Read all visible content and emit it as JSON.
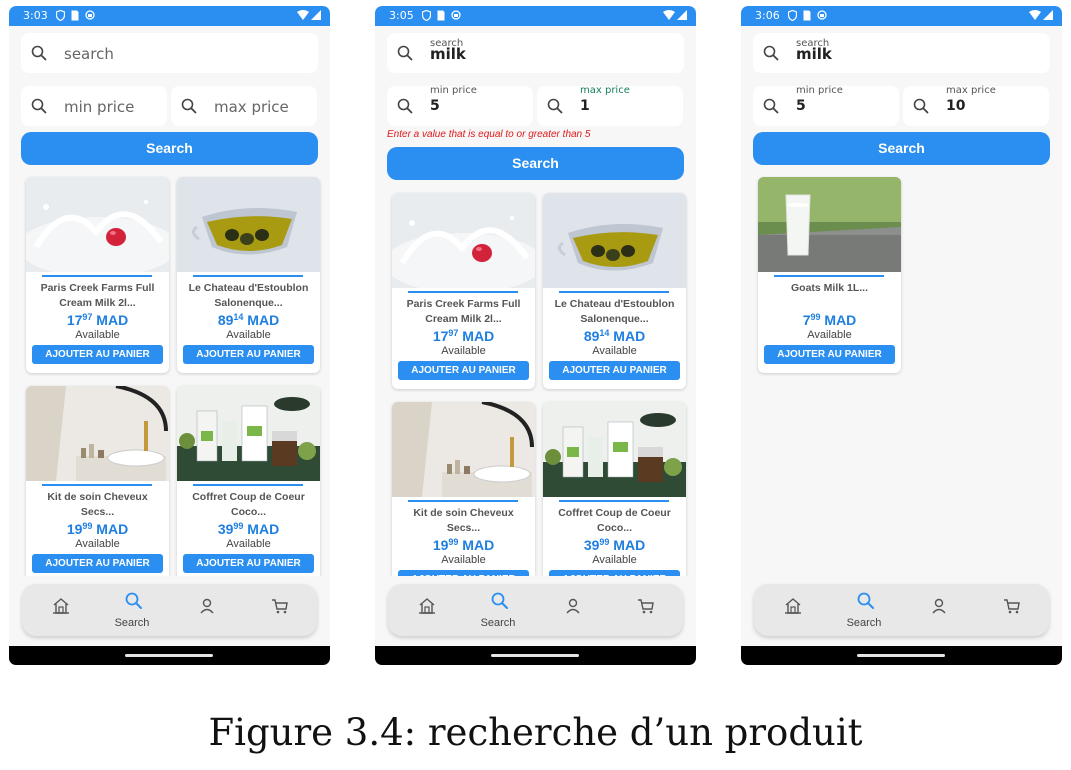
{
  "colors": {
    "accent": "#2a8ff0",
    "price": "#1e7fe0",
    "error": "#e01919",
    "label_green": "#17805a"
  },
  "screens": [
    {
      "time": "3:03",
      "search": {
        "label": "",
        "value": "",
        "placeholder": "search"
      },
      "min_price": {
        "label": "",
        "value": "",
        "placeholder": "min price"
      },
      "max_price": {
        "label": "",
        "value": "",
        "placeholder": "max price"
      },
      "error": "",
      "search_button": "Search",
      "products": [
        {
          "name1": "Paris Creek Farms Full",
          "name2": "Cream Milk 2l...",
          "price_int": "17",
          "price_dec": "97",
          "currency": "MAD",
          "availability": "Available",
          "cart": "AJOUTER AU PANIER",
          "image": "milk-splash"
        },
        {
          "name1": "Le Chateau d'Estoublon",
          "name2": "Salonenque...",
          "price_int": "89",
          "price_dec": "14",
          "currency": "MAD",
          "availability": "Available",
          "cart": "AJOUTER AU PANIER",
          "image": "olive-oil"
        },
        {
          "name1": "Kit de soin Cheveux",
          "name2": "Secs...",
          "price_int": "19",
          "price_dec": "99",
          "currency": "MAD",
          "availability": "Available",
          "cart": "AJOUTER AU PANIER",
          "image": "bathroom"
        },
        {
          "name1": "Coffret Coup de Coeur",
          "name2": "Coco...",
          "price_int": "39",
          "price_dec": "99",
          "currency": "MAD",
          "availability": "Available",
          "cart": "AJOUTER AU PANIER",
          "image": "cosmetics"
        }
      ],
      "nav": {
        "active": "Search"
      }
    },
    {
      "time": "3:05",
      "search": {
        "label": "search",
        "value": "milk",
        "placeholder": ""
      },
      "min_price": {
        "label": "min price",
        "value": "5",
        "placeholder": ""
      },
      "max_price": {
        "label": "max price",
        "value": "1",
        "placeholder": ""
      },
      "error": "Enter a value that is equal to or greater than 5",
      "search_button": "Search",
      "products": [
        {
          "name1": "Paris Creek Farms Full",
          "name2": "Cream Milk 2l...",
          "price_int": "17",
          "price_dec": "97",
          "currency": "MAD",
          "availability": "Available",
          "cart": "AJOUTER AU PANIER",
          "image": "milk-splash"
        },
        {
          "name1": "Le Chateau d'Estoublon",
          "name2": "Salonenque...",
          "price_int": "89",
          "price_dec": "14",
          "currency": "MAD",
          "availability": "Available",
          "cart": "AJOUTER AU PANIER",
          "image": "olive-oil"
        },
        {
          "name1": "Kit de soin Cheveux",
          "name2": "Secs...",
          "price_int": "19",
          "price_dec": "99",
          "currency": "MAD",
          "availability": "Available",
          "cart": "AJOUTER AU PANIER",
          "image": "bathroom"
        },
        {
          "name1": "Coffret Coup de Coeur",
          "name2": "Coco...",
          "price_int": "39",
          "price_dec": "99",
          "currency": "MAD",
          "availability": "Available",
          "cart": "AJOUTER AU PANIER",
          "image": "cosmetics"
        }
      ],
      "nav": {
        "active": "Search"
      }
    },
    {
      "time": "3:06",
      "search": {
        "label": "search",
        "value": "milk",
        "placeholder": ""
      },
      "min_price": {
        "label": "min price",
        "value": "5",
        "placeholder": ""
      },
      "max_price": {
        "label": "max price",
        "value": "10",
        "placeholder": ""
      },
      "error": "",
      "search_button": "Search",
      "products": [
        {
          "name1": "Goats Milk 1L...",
          "name2": "",
          "price_int": "7",
          "price_dec": "99",
          "currency": "MAD",
          "availability": "Available",
          "cart": "AJOUTER AU PANIER",
          "image": "milk-glass"
        }
      ],
      "nav": {
        "active": "Search"
      }
    }
  ],
  "caption": "Figure 3.4: recherche d’un produit"
}
